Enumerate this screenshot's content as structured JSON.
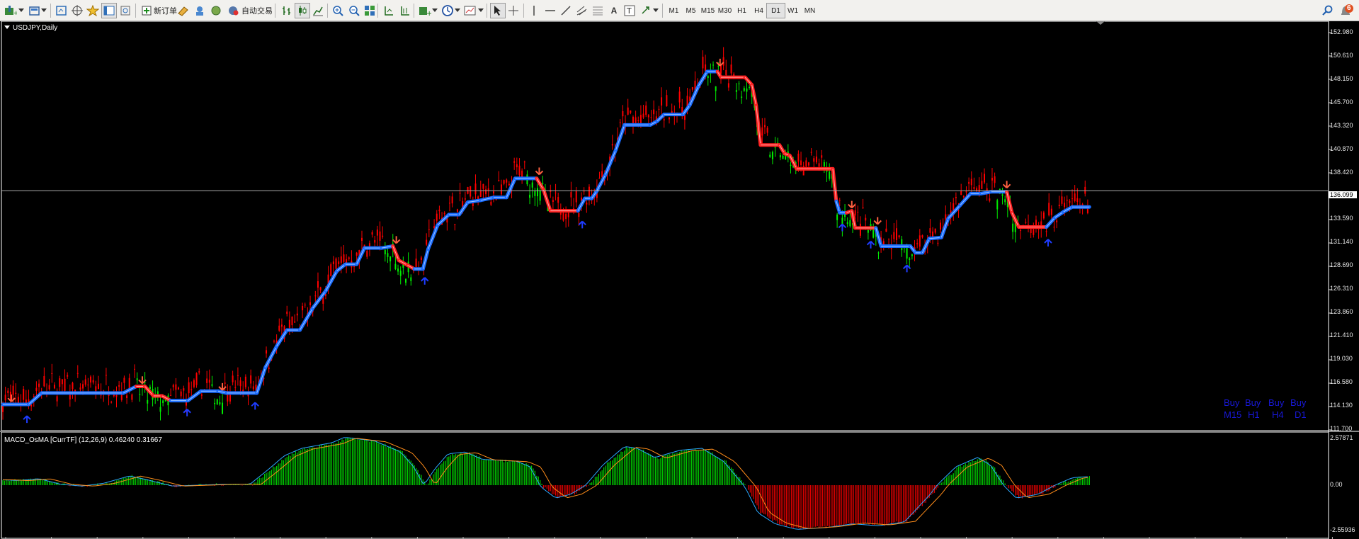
{
  "toolbar": {
    "new_order": "新订单",
    "auto_trading": "自动交易",
    "timeframes": [
      "M1",
      "M5",
      "M15",
      "M30",
      "H1",
      "H4",
      "D1",
      "W1",
      "MN"
    ],
    "active_timeframe": "D1",
    "notification_count": "6"
  },
  "chart": {
    "title": "USDJPY,Daily",
    "price_ticks": [
      "152.980",
      "150.610",
      "148.150",
      "145.700",
      "143.320",
      "140.870",
      "138.420",
      "136.099",
      "133.590",
      "131.140",
      "128.690",
      "126.310",
      "123.860",
      "121.410",
      "119.030",
      "116.580",
      "114.130",
      "111.700"
    ],
    "current_price": "136.099",
    "signals": {
      "row1": [
        "Buy",
        "Buy",
        "Buy",
        "Buy"
      ],
      "row2": [
        "M15",
        "H1",
        "H4",
        "D1"
      ]
    },
    "colors": {
      "up": "#ff0000",
      "down": "#00ee00",
      "trend_up": "#1a6cff",
      "trend_down": "#ff2020",
      "macd_pos": "#00c800",
      "macd_neg": "#e00000"
    }
  },
  "indicator": {
    "label": "MACD_OsMA [CurrTF] (12,26,9) 0.46240 0.31667",
    "ticks": [
      "2.57871",
      "0.00",
      "-2.55936"
    ]
  },
  "chart_data": {
    "type": "candlestick",
    "symbol": "USDJPY",
    "timeframe": "Daily",
    "ylim": [
      111.7,
      152.98
    ],
    "current_price": 136.099,
    "trend_line": [
      [
        0,
        113.7
      ],
      [
        30,
        113.7
      ],
      [
        45,
        114.9
      ],
      [
        140,
        114.9
      ],
      [
        155,
        115.6
      ],
      [
        165,
        115.6
      ],
      [
        175,
        114.6
      ],
      [
        185,
        114.6
      ],
      [
        195,
        114.1
      ],
      [
        215,
        114.1
      ],
      [
        230,
        115.1
      ],
      [
        250,
        115.1
      ],
      [
        260,
        114.9
      ],
      [
        295,
        114.9
      ],
      [
        305,
        117.6
      ],
      [
        318,
        119.8
      ],
      [
        330,
        121.5
      ],
      [
        345,
        121.5
      ],
      [
        360,
        123.8
      ],
      [
        375,
        125.6
      ],
      [
        388,
        127.7
      ],
      [
        398,
        128.4
      ],
      [
        411,
        128.4
      ],
      [
        420,
        130.1
      ],
      [
        440,
        130.1
      ],
      [
        453,
        130.3
      ],
      [
        460,
        128.8
      ],
      [
        470,
        128.3
      ],
      [
        478,
        127.9
      ],
      [
        488,
        127.9
      ],
      [
        494,
        130.0
      ],
      [
        505,
        132.5
      ],
      [
        518,
        133.6
      ],
      [
        530,
        133.6
      ],
      [
        540,
        134.9
      ],
      [
        555,
        135.1
      ],
      [
        570,
        135.4
      ],
      [
        585,
        135.4
      ],
      [
        595,
        137.4
      ],
      [
        620,
        137.4
      ],
      [
        628,
        136.2
      ],
      [
        636,
        134.0
      ],
      [
        668,
        134.0
      ],
      [
        676,
        135.3
      ],
      [
        684,
        135.3
      ],
      [
        690,
        136.1
      ],
      [
        700,
        137.8
      ],
      [
        712,
        140.4
      ],
      [
        722,
        143.0
      ],
      [
        752,
        143.0
      ],
      [
        760,
        143.4
      ],
      [
        768,
        144.1
      ],
      [
        790,
        144.1
      ],
      [
        798,
        145.1
      ],
      [
        808,
        147.1
      ],
      [
        818,
        148.6
      ],
      [
        830,
        148.6
      ],
      [
        834,
        148.0
      ],
      [
        862,
        148.0
      ],
      [
        870,
        147.2
      ],
      [
        875,
        145.0
      ],
      [
        880,
        140.9
      ],
      [
        902,
        140.9
      ],
      [
        908,
        140.0
      ],
      [
        914,
        139.8
      ],
      [
        922,
        138.4
      ],
      [
        964,
        138.4
      ],
      [
        968,
        135.0
      ],
      [
        972,
        133.8
      ],
      [
        980,
        133.8
      ],
      [
        986,
        134.0
      ],
      [
        990,
        132.2
      ],
      [
        1014,
        132.2
      ],
      [
        1020,
        130.3
      ],
      [
        1054,
        130.3
      ],
      [
        1060,
        129.6
      ],
      [
        1068,
        129.6
      ],
      [
        1076,
        131.1
      ],
      [
        1090,
        131.2
      ],
      [
        1098,
        133.2
      ],
      [
        1112,
        134.6
      ],
      [
        1124,
        135.8
      ],
      [
        1136,
        135.8
      ],
      [
        1148,
        136.0
      ],
      [
        1166,
        136.0
      ],
      [
        1172,
        133.8
      ],
      [
        1180,
        132.3
      ],
      [
        1212,
        132.3
      ],
      [
        1222,
        133.3
      ],
      [
        1232,
        133.9
      ],
      [
        1242,
        134.4
      ],
      [
        1262,
        134.4
      ]
    ],
    "arrows_down": [
      [
        10,
        114.0
      ],
      [
        162,
        115.9
      ],
      [
        255,
        115.2
      ],
      [
        457,
        130.6
      ],
      [
        623,
        137.8
      ],
      [
        833,
        149.2
      ],
      [
        986,
        134.3
      ],
      [
        1016,
        132.6
      ],
      [
        1166,
        136.4
      ]
    ],
    "arrows_up": [
      [
        28,
        112.8
      ],
      [
        214,
        113.5
      ],
      [
        293,
        114.2
      ],
      [
        490,
        127.3
      ],
      [
        673,
        133.2
      ],
      [
        975,
        132.9
      ],
      [
        1008,
        131.1
      ],
      [
        1050,
        128.6
      ],
      [
        1214,
        131.3
      ]
    ],
    "macd": {
      "label": "MACD_OsMA [CurrTF] (12,26,9)",
      "values": [
        0.4624,
        0.31667
      ],
      "ylim": [
        -2.55936,
        2.57871
      ],
      "histogram_profile": [
        [
          0,
          0.3
        ],
        [
          20,
          0.25
        ],
        [
          45,
          0.35
        ],
        [
          70,
          0.05
        ],
        [
          95,
          -0.05
        ],
        [
          120,
          0.1
        ],
        [
          150,
          0.5
        ],
        [
          170,
          0.3
        ],
        [
          200,
          -0.05
        ],
        [
          230,
          0.0
        ],
        [
          260,
          0.05
        ],
        [
          290,
          0.05
        ],
        [
          310,
          0.8
        ],
        [
          330,
          1.6
        ],
        [
          350,
          2.0
        ],
        [
          385,
          2.3
        ],
        [
          400,
          2.6
        ],
        [
          435,
          2.4
        ],
        [
          465,
          1.8
        ],
        [
          480,
          1.0
        ],
        [
          492,
          0.0
        ],
        [
          505,
          0.9
        ],
        [
          520,
          1.7
        ],
        [
          540,
          1.8
        ],
        [
          560,
          1.4
        ],
        [
          600,
          1.3
        ],
        [
          615,
          1.0
        ],
        [
          628,
          -0.1
        ],
        [
          645,
          -0.7
        ],
        [
          662,
          -0.5
        ],
        [
          680,
          0.0
        ],
        [
          700,
          1.1
        ],
        [
          725,
          2.1
        ],
        [
          740,
          2.0
        ],
        [
          760,
          1.5
        ],
        [
          790,
          1.9
        ],
        [
          815,
          2.0
        ],
        [
          840,
          1.3
        ],
        [
          865,
          -0.1
        ],
        [
          880,
          -1.5
        ],
        [
          900,
          -2.1
        ],
        [
          925,
          -2.4
        ],
        [
          960,
          -2.3
        ],
        [
          990,
          -2.1
        ],
        [
          1020,
          -2.2
        ],
        [
          1050,
          -2.0
        ],
        [
          1080,
          -0.5
        ],
        [
          1088,
          0.0
        ],
        [
          1110,
          1.0
        ],
        [
          1135,
          1.5
        ],
        [
          1150,
          1.1
        ],
        [
          1165,
          0.0
        ],
        [
          1180,
          -0.7
        ],
        [
          1205,
          -0.5
        ],
        [
          1225,
          0.0
        ],
        [
          1245,
          0.4
        ],
        [
          1262,
          0.46
        ]
      ]
    }
  }
}
